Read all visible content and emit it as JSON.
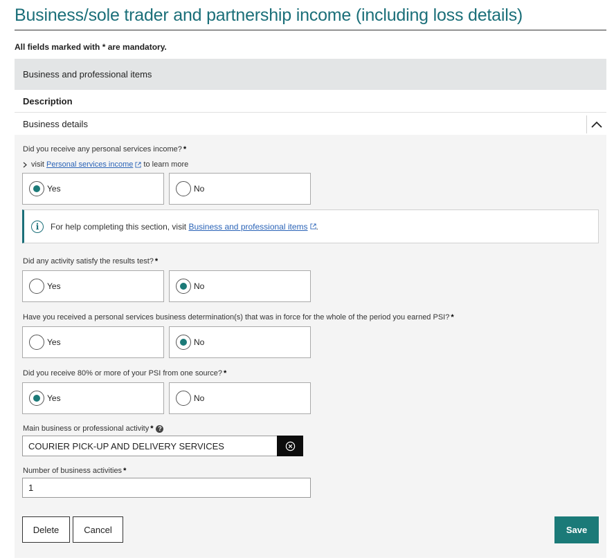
{
  "page": {
    "title": "Business/sole trader and partnership income (including loss details)",
    "mandatory_note": "All fields marked with * are mandatory."
  },
  "section": {
    "header": "Business and professional items",
    "description_label": "Description",
    "detail_label": "Business details"
  },
  "questions": {
    "q1": {
      "label": "Did you receive any personal services income?",
      "visit_prefix": "visit",
      "visit_link": "Personal services income",
      "visit_suffix": "to learn more",
      "yes": "Yes",
      "no": "No",
      "selected": "Yes"
    },
    "info": {
      "text": "For help completing this section, visit",
      "link": "Business and professional items",
      "end": "."
    },
    "q2": {
      "label": "Did any activity satisfy the results test?",
      "yes": "Yes",
      "no": "No",
      "selected": "No"
    },
    "q3": {
      "label": "Have you received a personal services business determination(s) that was in force for the whole of the period you earned PSI?",
      "yes": "Yes",
      "no": "No",
      "selected": "No"
    },
    "q4": {
      "label": "Did you receive 80% or more of your PSI from one source?",
      "yes": "Yes",
      "no": "No",
      "selected": "Yes"
    }
  },
  "fields": {
    "main_activity": {
      "label": "Main business or professional activity",
      "value": "COURIER PICK-UP AND DELIVERY SERVICES"
    },
    "num_activities": {
      "label": "Number of business activities",
      "value": "1"
    }
  },
  "required_marker": "*",
  "buttons": {
    "delete": "Delete",
    "cancel": "Cancel",
    "save": "Save"
  },
  "colors": {
    "accent": "#1b7a78",
    "title": "#1b6f79",
    "link": "#2a63b7"
  }
}
